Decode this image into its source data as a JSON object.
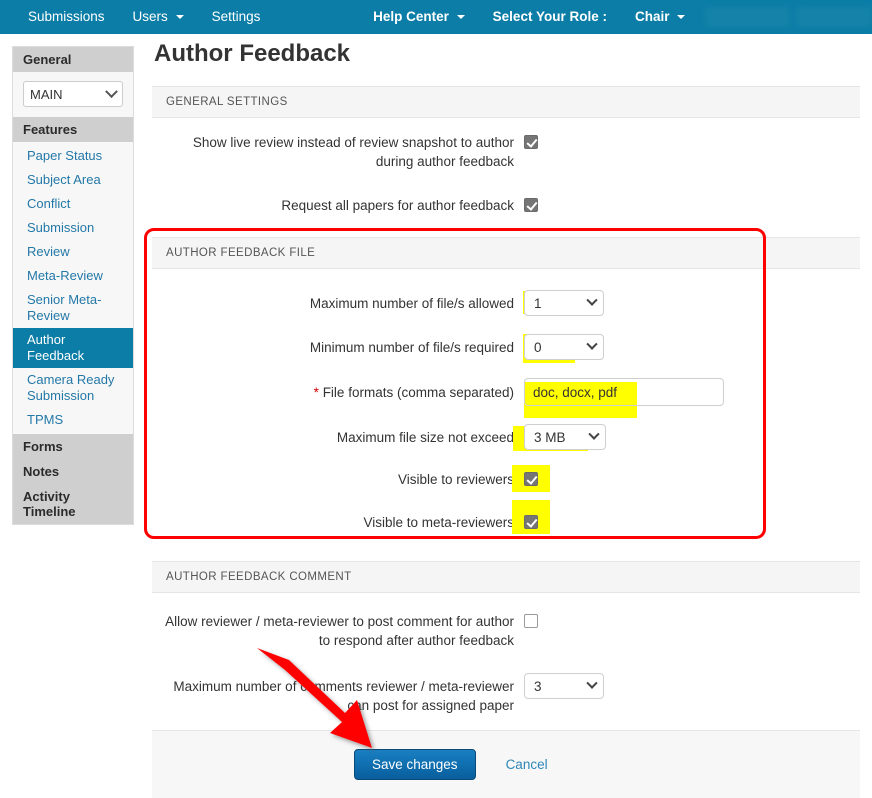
{
  "navbar": {
    "brand_color": "#0b7da6",
    "items": [
      {
        "label": "Submissions",
        "has_caret": false,
        "bold": false
      },
      {
        "label": "Users",
        "has_caret": true,
        "bold": false
      },
      {
        "label": "Settings",
        "has_caret": false,
        "bold": false
      }
    ],
    "right_items": [
      {
        "label": "Help Center",
        "has_caret": true,
        "bold": true
      },
      {
        "label": "Select Your Role :",
        "has_caret": false,
        "bold": true
      },
      {
        "label": "Chair",
        "has_caret": true,
        "bold": true
      }
    ]
  },
  "sidebar": {
    "general_header": "General",
    "track_select_value": "MAIN",
    "features_header": "Features",
    "features": [
      {
        "label": "Paper Status",
        "active": false
      },
      {
        "label": "Subject Area",
        "active": false
      },
      {
        "label": "Conflict",
        "active": false
      },
      {
        "label": "Submission",
        "active": false
      },
      {
        "label": "Review",
        "active": false
      },
      {
        "label": "Meta-Review",
        "active": false
      },
      {
        "label": "Senior Meta-Review",
        "active": false
      },
      {
        "label": "Author Feedback",
        "active": true
      },
      {
        "label": "Camera Ready Submission",
        "active": false
      },
      {
        "label": "TPMS",
        "active": false
      }
    ],
    "sections": [
      {
        "label": "Forms"
      },
      {
        "label": "Notes"
      },
      {
        "label": "Activity Timeline"
      }
    ]
  },
  "page": {
    "title": "Author Feedback"
  },
  "general_settings": {
    "heading": "GENERAL SETTINGS",
    "rows": [
      {
        "label": "Show live review instead of review snapshot to author during author feedback",
        "checked": true
      },
      {
        "label": "Request all papers for author feedback",
        "checked": true
      }
    ]
  },
  "author_feedback_file": {
    "heading": "AUTHOR FEEDBACK FILE",
    "max_files_label": "Maximum number of file/s allowed",
    "max_files_value": "1",
    "min_files_label": "Minimum number of file/s required",
    "min_files_value": "0",
    "file_formats_label": "File formats (comma separated)",
    "file_formats_required_mark": "*",
    "file_formats_value": "doc, docx, pdf",
    "max_size_label": "Maximum file size not exceed",
    "max_size_value": "3 MB",
    "visible_reviewers_label": "Visible to reviewers",
    "visible_reviewers_checked": true,
    "visible_meta_label": "Visible to meta-reviewers",
    "visible_meta_checked": true,
    "highlight_color": "#ffff00",
    "annotation_box_color": "#ff0000"
  },
  "author_feedback_comment": {
    "heading": "AUTHOR FEEDBACK COMMENT",
    "allow_comment_label": "Allow reviewer / meta-reviewer to post comment for author to respond after author feedback",
    "allow_comment_checked": false,
    "max_comments_label": "Maximum number of comments reviewer / meta-reviewer can post for assigned paper",
    "max_comments_value": "3"
  },
  "footer": {
    "save_label": "Save changes",
    "cancel_label": "Cancel",
    "arrow_color": "#ff0000"
  }
}
